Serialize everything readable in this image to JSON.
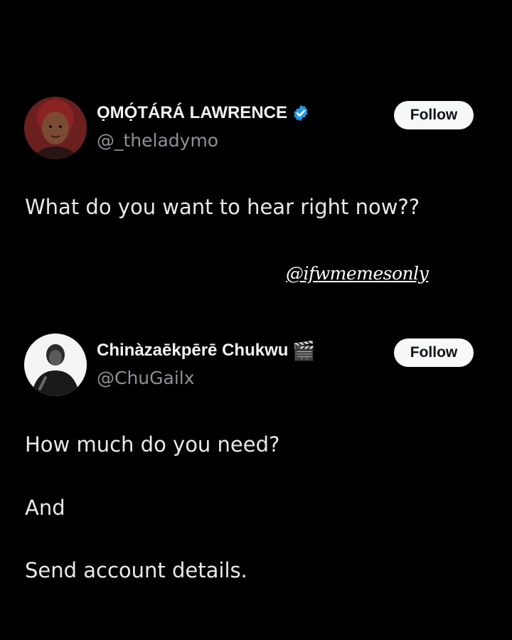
{
  "tweets": [
    {
      "author_name": "ỌMỌ́TÁRÁ LAWRENCE",
      "handle": "@_theladymo",
      "verified_icon": "verified-badge-icon",
      "follow_label": "Follow",
      "text": "What do you want to hear right now??"
    },
    {
      "author_name": "Chinàzaēkpērē Chukwu",
      "name_emoji": "🎬",
      "handle": "@ChuGailx",
      "follow_label": "Follow",
      "lines": [
        "How much do you need?",
        "And",
        "Send account details."
      ]
    }
  ],
  "watermark": "@ifwmemesonly",
  "colors": {
    "background": "#000000",
    "text": "#e7e9ea",
    "handle": "#8b9197",
    "verified": "#1d9bf0",
    "follow_bg": "#f7f9f9",
    "follow_text": "#0f1419"
  }
}
